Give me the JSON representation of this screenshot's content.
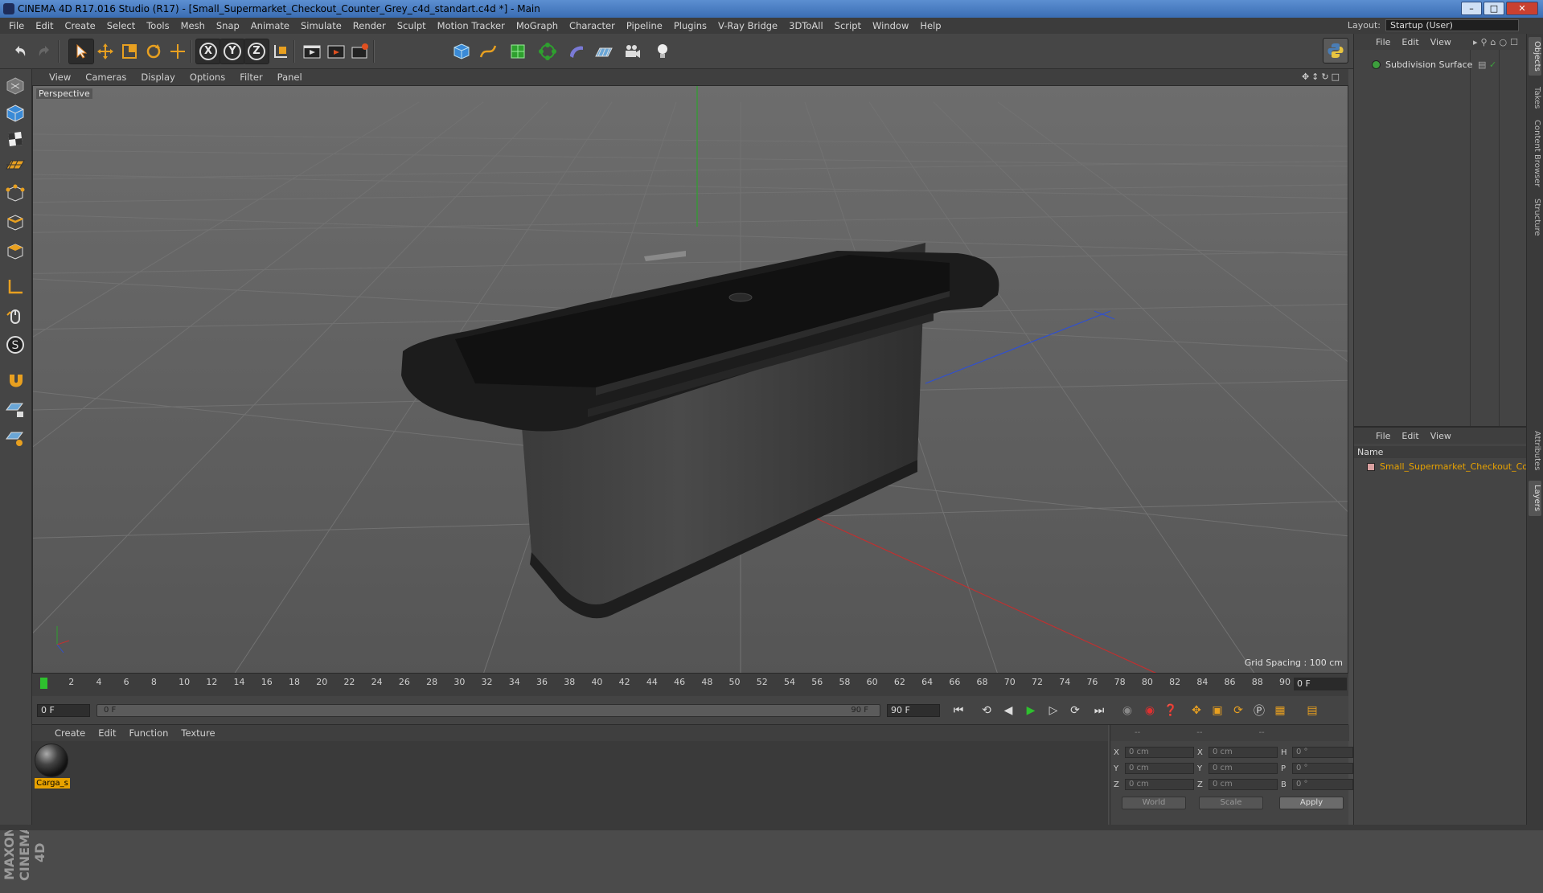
{
  "window": {
    "title": "CINEMA 4D R17.016 Studio (R17) - [Small_Supermarket_Checkout_Counter_Grey_c4d_standart.c4d *] - Main",
    "min_icon": "minimize-icon",
    "max_icon": "maximize-icon",
    "close_icon": "close-icon"
  },
  "menubar": [
    "File",
    "Edit",
    "Create",
    "Select",
    "Tools",
    "Mesh",
    "Snap",
    "Animate",
    "Simulate",
    "Render",
    "Sculpt",
    "Motion Tracker",
    "MoGraph",
    "Character",
    "Pipeline",
    "Plugins",
    "V-Ray Bridge",
    "3DToAll",
    "Script",
    "Window",
    "Help"
  ],
  "layout": {
    "label": "Layout:",
    "value": "Startup (User)"
  },
  "toolbar": {
    "axis_x": "X",
    "axis_y": "Y",
    "axis_z": "Z",
    "icons": [
      "undo-icon",
      "redo-icon",
      "select-arrow-icon",
      "move-icon",
      "scale-icon",
      "rotate-icon",
      "add-live-selection-icon",
      "x-axis-icon",
      "y-axis-icon",
      "z-axis-icon",
      "coordinate-system-icon",
      "render-view-icon",
      "render-picture-viewer-icon",
      "edit-render-settings-icon",
      "cube-primitive-icon",
      "spline-pen-icon",
      "subdivision-surface-icon",
      "array-icon",
      "deformer-icon",
      "floor-icon",
      "camera-icon",
      "light-icon",
      "python-icon"
    ]
  },
  "viewport_menu": [
    "View",
    "Cameras",
    "Display",
    "Options",
    "Filter",
    "Panel"
  ],
  "viewport": {
    "label": "Perspective",
    "grid_spacing": "Grid Spacing : 100 cm",
    "accent_colors": {
      "x_axis": "#c03030",
      "y_axis": "#2ea02e",
      "z_axis": "#3050d0"
    }
  },
  "timeline": {
    "ticks": [
      "0",
      "2",
      "4",
      "6",
      "8",
      "10",
      "12",
      "14",
      "16",
      "18",
      "20",
      "22",
      "24",
      "26",
      "28",
      "30",
      "32",
      "34",
      "36",
      "38",
      "40",
      "42",
      "44",
      "46",
      "48",
      "50",
      "52",
      "54",
      "56",
      "58",
      "60",
      "62",
      "64",
      "66",
      "68",
      "70",
      "72",
      "74",
      "76",
      "78",
      "80",
      "82",
      "84",
      "86",
      "88",
      "90"
    ],
    "current_frame": "0 F"
  },
  "playback": {
    "start_field": "0 F",
    "slider_left": "0 F",
    "slider_right": "90 F",
    "end_field": "90 F"
  },
  "material_menu": [
    "Create",
    "Edit",
    "Function",
    "Texture"
  ],
  "materials": [
    {
      "name": "Carga_s"
    }
  ],
  "coords": {
    "header": [
      "--",
      "--",
      "--"
    ],
    "rows": [
      {
        "a": "X",
        "v1": "0 cm",
        "b": "X",
        "v2": "0 cm",
        "c": "H",
        "v3": "0 °"
      },
      {
        "a": "Y",
        "v1": "0 cm",
        "b": "Y",
        "v2": "0 cm",
        "c": "P",
        "v3": "0 °"
      },
      {
        "a": "Z",
        "v1": "0 cm",
        "b": "Z",
        "v2": "0 cm",
        "c": "B",
        "v3": "0 °"
      }
    ],
    "world": "World",
    "scale": "Scale",
    "apply": "Apply"
  },
  "object_manager": {
    "menu": [
      "File",
      "Edit",
      "View"
    ],
    "objects": [
      {
        "name": "Subdivision Surface"
      }
    ]
  },
  "layer_manager": {
    "menu": [
      "File",
      "Edit",
      "View"
    ],
    "name_header": "Name",
    "items": [
      {
        "name": "Small_Supermarket_Checkout_Co"
      }
    ]
  },
  "side_tabs": [
    "Objects",
    "Takes",
    "Content Browser",
    "Structure",
    "Attributes",
    "Layers"
  ],
  "logo": "MAXON CINEMA 4D"
}
